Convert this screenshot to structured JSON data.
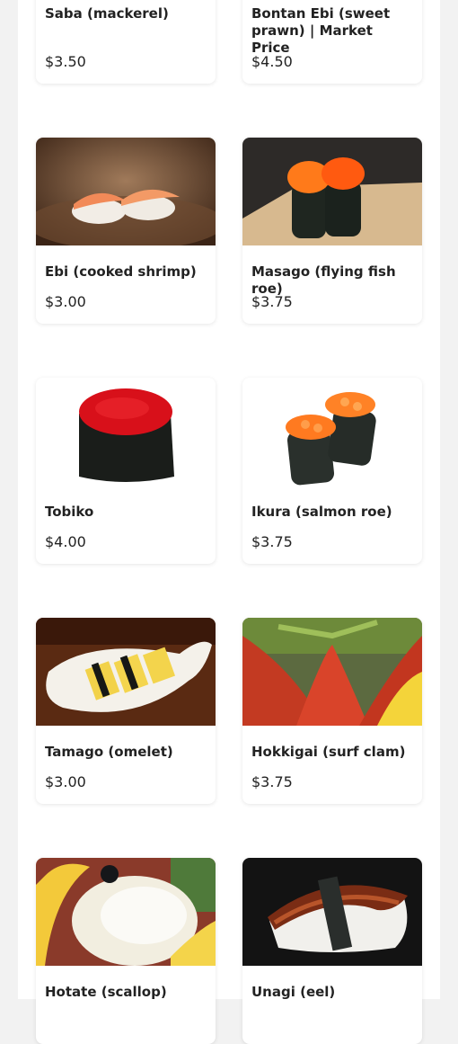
{
  "menu": {
    "items": [
      {
        "name": "Saba (mackerel)",
        "price": "$3.50",
        "icon": "saba-photo"
      },
      {
        "name": "Bontan Ebi (sweet prawn) | Market Price",
        "price": "$4.50",
        "icon": "bontan-ebi-photo"
      },
      {
        "name": "Ebi (cooked shrimp)",
        "price": "$3.00",
        "icon": "ebi-photo"
      },
      {
        "name": "Masago (flying fish roe)",
        "price": "$3.75",
        "icon": "masago-photo"
      },
      {
        "name": "Tobiko",
        "price": "$4.00",
        "icon": "tobiko-photo"
      },
      {
        "name": "Ikura (salmon roe)",
        "price": "$3.75",
        "icon": "ikura-photo"
      },
      {
        "name": "Tamago (omelet)",
        "price": "$3.00",
        "icon": "tamago-photo"
      },
      {
        "name": "Hokkigai (surf clam)",
        "price": "$3.75",
        "icon": "hokkigai-photo"
      },
      {
        "name": "Hotate (scallop)",
        "price": "",
        "icon": "hotate-photo"
      },
      {
        "name": "Unagi (eel)",
        "price": "",
        "icon": "unagi-photo"
      }
    ]
  }
}
